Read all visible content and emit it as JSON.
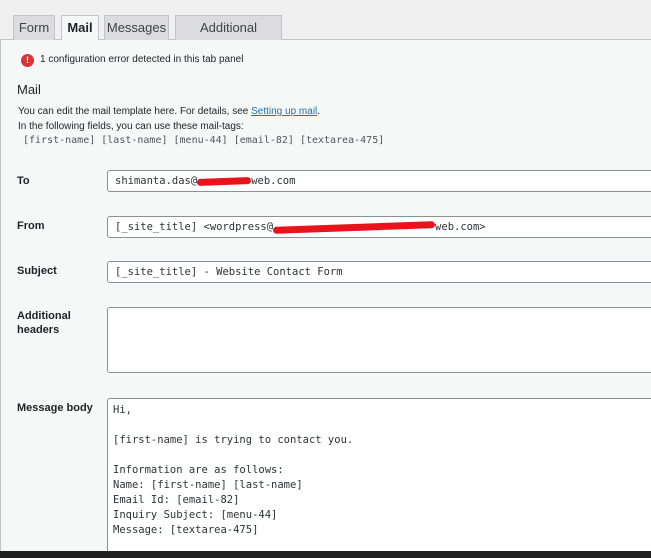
{
  "tabs": [
    {
      "label": "Form"
    },
    {
      "label": "Mail"
    },
    {
      "label": "Messages"
    },
    {
      "label": "Additional Settings"
    }
  ],
  "error": {
    "icon": "!",
    "message": "1 configuration error detected in this tab panel"
  },
  "section": {
    "title": "Mail",
    "desc_line1_prefix": "You can edit the mail template here. For details, see ",
    "desc_link": "Setting up mail",
    "desc_line1_suffix": ".",
    "desc_line2": "In the following fields, you can use these mail-tags:",
    "mailtags": "[first-name] [last-name] [menu-44] [email-82] [textarea-475]"
  },
  "fields": {
    "to": {
      "label": "To",
      "value_prefix": "shimanta.das@",
      "value_suffix": "web.com"
    },
    "from": {
      "label": "From",
      "value_prefix": "[_site_title] <wordpress@",
      "value_suffix": "web.com>"
    },
    "subject": {
      "label": "Subject",
      "value": "[_site_title] - Website Contact Form"
    },
    "additional_headers": {
      "label_line1": "Additional",
      "label_line2": "headers",
      "value": ""
    },
    "message_body": {
      "label": "Message body",
      "value": "Hi,\n\n[first-name] is trying to contact you.\n\nInformation are as follows:\nName: [first-name] [last-name]\nEmail Id: [email-82]\nInquiry Subject: [menu-44]\nMessage: [textarea-475]"
    }
  },
  "colors": {
    "error_icon": "#d63638",
    "link": "#2271b1",
    "redaction": "#e8131b"
  }
}
